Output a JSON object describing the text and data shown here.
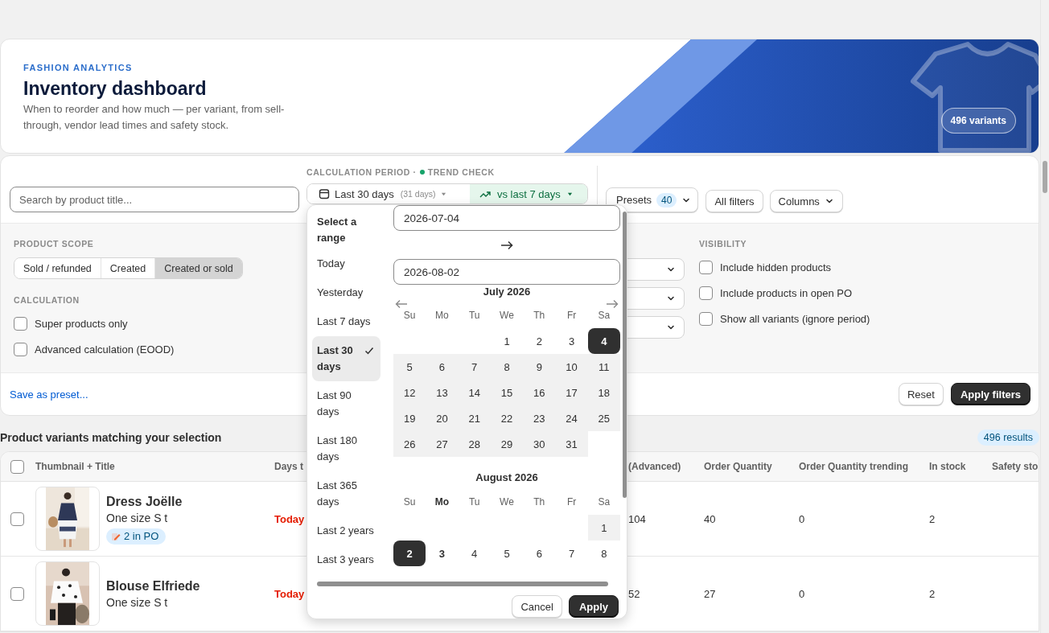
{
  "header": {
    "eyebrow": "FASHION ANALYTICS",
    "title": "Inventory dashboard",
    "subtitle": "When to reorder and how much — per variant, from sell-through, vendor lead times and safety stock.",
    "variants_badge": "496 variants"
  },
  "toolbar": {
    "search": {
      "placeholder": "Search by product title..."
    },
    "period_label": "CALCULATION PERIOD ·",
    "trend_label": "TREND CHECK",
    "period": {
      "label": "Last 30 days",
      "days": "(31 days)"
    },
    "trend": {
      "label": "vs last 7 days"
    },
    "presets": {
      "label": "Presets",
      "count": "40"
    },
    "all_filters": "All filters",
    "columns": "Columns"
  },
  "filters": {
    "product_scope": {
      "title": "PRODUCT SCOPE",
      "options": [
        {
          "label": "Sold / refunded",
          "selected": false
        },
        {
          "label": "Created",
          "selected": false
        },
        {
          "label": "Created or sold",
          "selected": true
        }
      ]
    },
    "calculation": {
      "title": "CALCULATION",
      "options": [
        {
          "label": "Super products only",
          "checked": false
        },
        {
          "label": "Advanced calculation (EOOD)",
          "checked": false
        }
      ]
    },
    "dropdowns": [
      {
        "kind": "select"
      },
      {
        "kind": "select"
      },
      {
        "kind": "select"
      }
    ],
    "visibility": {
      "title": "VISIBILITY",
      "options": [
        {
          "label": "Include hidden products",
          "checked": false
        },
        {
          "label": "Include products in open PO",
          "checked": false
        },
        {
          "label": "Show all variants (ignore period)",
          "checked": false
        }
      ]
    }
  },
  "filter_footer": {
    "save_preset": "Save as preset...",
    "reset": "Reset",
    "apply": "Apply filters"
  },
  "results": {
    "title": "Product variants matching your selection",
    "count": "496 results"
  },
  "table": {
    "all_selected": false,
    "title_column": "Thumbnail + Title",
    "columns": [
      "Days t",
      "(Advanced)",
      "Order Quantity",
      "Order Quantity trending",
      "In stock",
      "Safety sto"
    ],
    "rows": [
      {
        "selected": false,
        "thumbnail": {
          "kind": "picture"
        },
        "title": "Dress Joëlle",
        "variant": "One size S t",
        "po_badge": "2 in PO",
        "cells": [
          {
            "text": "Today",
            "alert": true
          },
          {
            "text": "104",
            "alert": false
          },
          {
            "text": "40",
            "alert": false
          },
          {
            "text": "0",
            "alert": false
          },
          {
            "text": "2",
            "alert": false
          }
        ]
      },
      {
        "selected": false,
        "thumbnail": {
          "kind": "picture"
        },
        "title": "Blouse Elfriede",
        "variant": "One size S t",
        "cells": [
          {
            "text": "Today",
            "alert": true
          },
          {
            "text": "52",
            "alert": false
          },
          {
            "text": "27",
            "alert": false
          },
          {
            "text": "0",
            "alert": false
          },
          {
            "text": "2",
            "alert": false
          }
        ]
      }
    ]
  },
  "picker": {
    "title": "Select a range",
    "presets": [
      {
        "label": "Today",
        "selected": false
      },
      {
        "label": "Yesterday",
        "selected": false
      },
      {
        "label": "Last 7 days",
        "selected": false
      },
      {
        "label": "Last 30 days",
        "selected": true
      },
      {
        "label": "Last 90 days",
        "selected": false
      },
      {
        "label": "Last 180 days",
        "selected": false
      },
      {
        "label": "Last 365 days",
        "selected": false
      },
      {
        "label": "Last 2 years",
        "selected": false
      },
      {
        "label": "Last 3 years",
        "selected": false
      }
    ],
    "start_date": "2026-07-04",
    "end_date": "2026-08-02",
    "months": [
      {
        "title": "July 2026",
        "weekdays": [
          {
            "label": "Su",
            "current": false
          },
          {
            "label": "Mo",
            "current": false
          },
          {
            "label": "Tu",
            "current": false
          },
          {
            "label": "We",
            "current": false
          },
          {
            "label": "Th",
            "current": false
          },
          {
            "label": "Fr",
            "current": false
          },
          {
            "label": "Sa",
            "current": false
          }
        ],
        "weeks": [
          [
            {
              "day": "1",
              "selected": false,
              "in_range": false,
              "today": false
            },
            {
              "day": "2",
              "selected": false,
              "in_range": false,
              "today": false
            },
            {
              "day": "3",
              "selected": false,
              "in_range": false,
              "today": false
            },
            {
              "day": "4",
              "selected": true
            }
          ],
          [
            {
              "day": "5",
              "selected": false,
              "in_range": true,
              "today": false
            },
            {
              "day": "6",
              "selected": false,
              "in_range": true,
              "today": false
            },
            {
              "day": "7",
              "selected": false,
              "in_range": true,
              "today": false
            },
            {
              "day": "8",
              "selected": false,
              "in_range": true,
              "today": false
            },
            {
              "day": "9",
              "selected": false,
              "in_range": true,
              "today": false
            },
            {
              "day": "10",
              "selected": false,
              "in_range": true,
              "today": false
            },
            {
              "day": "11",
              "selected": false,
              "in_range": true,
              "today": false
            }
          ],
          [
            {
              "day": "12",
              "selected": false,
              "in_range": true,
              "today": false
            },
            {
              "day": "13",
              "selected": false,
              "in_range": true,
              "today": false
            },
            {
              "day": "14",
              "selected": false,
              "in_range": true,
              "today": false
            },
            {
              "day": "15",
              "selected": false,
              "in_range": true,
              "today": false
            },
            {
              "day": "16",
              "selected": false,
              "in_range": true,
              "today": false
            },
            {
              "day": "17",
              "selected": false,
              "in_range": true,
              "today": false
            },
            {
              "day": "18",
              "selected": false,
              "in_range": true,
              "today": false
            }
          ],
          [
            {
              "day": "19",
              "selected": false,
              "in_range": true,
              "today": false
            },
            {
              "day": "20",
              "selected": false,
              "in_range": true,
              "today": false
            },
            {
              "day": "21",
              "selected": false,
              "in_range": true,
              "today": false
            },
            {
              "day": "22",
              "selected": false,
              "in_range": true,
              "today": false
            },
            {
              "day": "23",
              "selected": false,
              "in_range": true,
              "today": false
            },
            {
              "day": "24",
              "selected": false,
              "in_range": true,
              "today": false
            },
            {
              "day": "25",
              "selected": false,
              "in_range": true,
              "today": false
            }
          ],
          [
            {
              "day": "26",
              "selected": false,
              "in_range": true,
              "today": false
            },
            {
              "day": "27",
              "selected": false,
              "in_range": true,
              "today": false
            },
            {
              "day": "28",
              "selected": false,
              "in_range": true,
              "today": false
            },
            {
              "day": "29",
              "selected": false,
              "in_range": true,
              "today": false
            },
            {
              "day": "30",
              "selected": false,
              "in_range": true,
              "today": false
            },
            {
              "day": "31",
              "selected": false,
              "in_range": true,
              "today": false
            }
          ]
        ]
      },
      {
        "title": "August 2026",
        "weekdays": [
          {
            "label": "Su",
            "current": false
          },
          {
            "label": "Mo",
            "current": true
          },
          {
            "label": "Tu",
            "current": false
          },
          {
            "label": "We",
            "current": false
          },
          {
            "label": "Th",
            "current": false
          },
          {
            "label": "Fr",
            "current": false
          },
          {
            "label": "Sa",
            "current": false
          }
        ],
        "weeks": [
          [
            {
              "day": "1",
              "selected": false,
              "in_range": true,
              "today": false
            }
          ],
          [
            {
              "day": "2",
              "selected": true
            },
            {
              "day": "3",
              "selected": false,
              "in_range": false,
              "today": true
            },
            {
              "day": "4",
              "selected": false,
              "in_range": false,
              "today": false
            },
            {
              "day": "5",
              "selected": false,
              "in_range": false,
              "today": false
            },
            {
              "day": "6",
              "selected": false,
              "in_range": false,
              "today": false
            },
            {
              "day": "7",
              "selected": false,
              "in_range": false,
              "today": false
            },
            {
              "day": "8",
              "selected": false,
              "in_range": false,
              "today": false
            }
          ]
        ]
      }
    ],
    "cancel": "Cancel",
    "apply": "Apply"
  }
}
